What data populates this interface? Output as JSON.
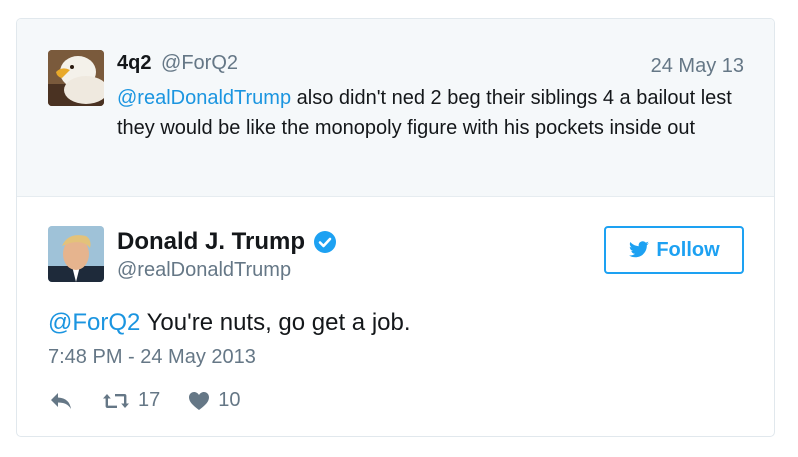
{
  "reply_context": {
    "name": "4q2",
    "handle": "@ForQ2",
    "date": "24 May 13",
    "mention": "@realDonaldTrump",
    "text": " also didn't ned 2 beg their siblings 4 a bailout lest they would be like the monopoly figure with his pockets inside out"
  },
  "tweet": {
    "name": "Donald J. Trump",
    "handle": "@realDonaldTrump",
    "verified_icon": "verified-badge-icon",
    "follow_label": "Follow",
    "mention": "@ForQ2",
    "text": " You're nuts, go get a job.",
    "timestamp": "7:48 PM - 24 May 2013",
    "retweets": "17",
    "likes": "10"
  },
  "colors": {
    "accent": "#1da1f2",
    "mention": "#1b95e0",
    "muted": "#657786",
    "context_bg": "#f5f8fa"
  }
}
